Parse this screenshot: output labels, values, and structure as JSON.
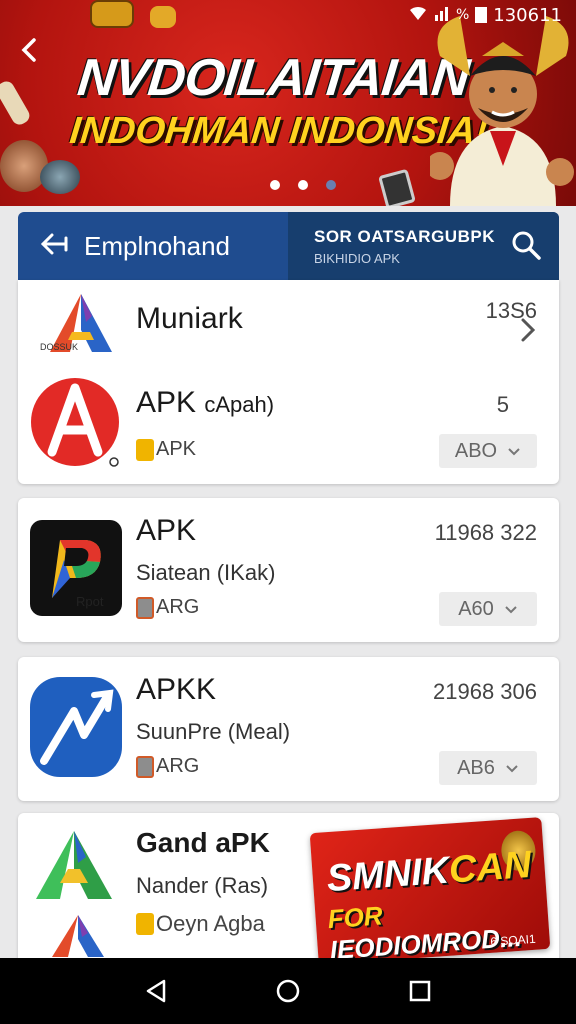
{
  "status_bar": {
    "time": "130611"
  },
  "banner": {
    "title_line1": "NVDOILAITAIAN",
    "title_line2": "INDOHMAN INDONSIA!",
    "slide_count": 3,
    "active_slide": 1
  },
  "header": {
    "title": "Emplnohand",
    "search_line1": "SOR OATSARGUBPK",
    "search_line2": "BIKHIDIO APK"
  },
  "apps": [
    {
      "icon": "a-triangle-logo-icon",
      "icon_caption": "DOSSUK",
      "name": "Muniark",
      "count": "13S6"
    },
    {
      "icon": "a-red-circle-logo-icon",
      "name": "APK",
      "name_suffix": "cApah)",
      "tag": "APK",
      "count": "5",
      "dropdown": "ABO"
    },
    {
      "icon": "p-colorful-logo-icon",
      "icon_caption": "Rpot",
      "name": "APK",
      "subtitle": "Siatean (IKak)",
      "tag": "ARG",
      "count": "11968 322",
      "dropdown": "A60"
    },
    {
      "icon": "blue-arrow-logo-icon",
      "name": "APKK",
      "subtitle": "SuunPre (Meal)",
      "tag": "ARG",
      "count": "21968 306",
      "dropdown": "AB6"
    },
    {
      "icon": "green-triangle-logo-icon",
      "name": "Gand aPK",
      "subtitle": "Nander (Ras)",
      "tag": "Oeyn Agba"
    }
  ],
  "promo": {
    "line1_a": "SMNIK",
    "line1_b": "CAN",
    "line2_a": "FOR",
    "line2_b": " IEODIOMROD...",
    "caption": "6 SOAI1"
  },
  "colors": {
    "header_blue": "#1f4c8f",
    "banner_red": "#c41a12",
    "accent_yellow": "#ffd21f"
  }
}
